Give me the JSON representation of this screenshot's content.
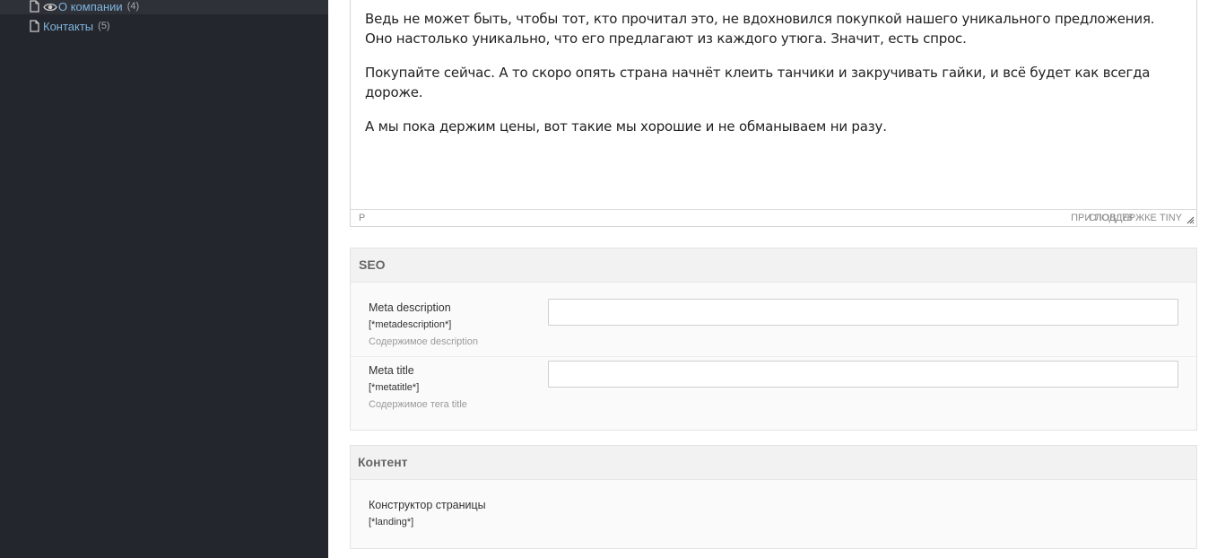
{
  "sidebar": {
    "items": [
      {
        "label": "О компании",
        "count": "(4)"
      },
      {
        "label": "Контакты",
        "count": "(5)"
      }
    ]
  },
  "editor": {
    "paragraphs": [
      "Ведь не может быть, чтобы тот, кто прочитал это, не вдохновился покупкой нашего уникального предложения. Оно настолько уникально, что его предлагают из каждого утюга. Значит, есть спрос.",
      "Покупайте сейчас. А то скоро опять страна начнёт клеить танчики и закручивать гайки, и всё будет как всегда дороже.",
      "А мы пока держим цены, вот такие мы хорошие и не обманываем ни разу."
    ],
    "status_path": "P",
    "word_count": "СЛОВ: 78",
    "powered_by": "ПРИ ПОДДЕРЖКЕ TINY"
  },
  "seo": {
    "title": "SEO",
    "fields": [
      {
        "name": "Meta description",
        "tag": "[*metadescription*]",
        "hint": "Содержимое description",
        "value": ""
      },
      {
        "name": "Meta title",
        "tag": "[*metatitle*]",
        "hint": "Содержимое тега title",
        "value": ""
      }
    ]
  },
  "content": {
    "title": "Контент",
    "fields": [
      {
        "name": "Конструктор страницы",
        "tag": "[*landing*]"
      }
    ]
  },
  "colors": {
    "sidebar_bg": "#23262d",
    "link": "#7fb3dc"
  },
  "icons": {
    "document": "document-icon",
    "eye": "eye-icon",
    "resize": "resize-handle-icon"
  }
}
